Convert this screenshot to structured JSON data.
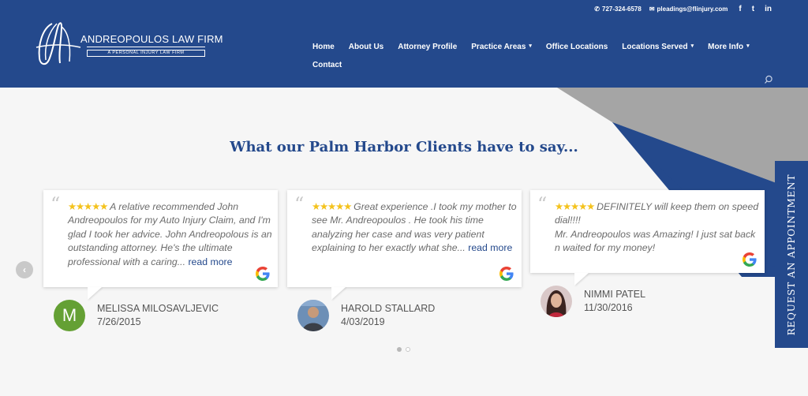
{
  "header": {
    "phone": "727-324-6578",
    "email": "pleadings@flinjury.com",
    "social": {
      "facebook": "f",
      "twitter": "t",
      "linkedin": "in"
    },
    "logo": {
      "name": "ANDREOPOULOS LAW FIRM",
      "tagline": "A PERSONAL INJURY LAW FIRM"
    },
    "nav_row1": [
      "Home",
      "About Us",
      "Attorney Profile",
      "Practice Areas",
      "Office Locations",
      "Locations Served",
      "More Info"
    ],
    "nav_row2": [
      "Contact"
    ],
    "nav_dropdowns": [
      "Practice Areas",
      "Locations Served",
      "More Info"
    ]
  },
  "section": {
    "heading": "What our Palm Harbor Clients have to say..."
  },
  "reviews": [
    {
      "stars": "★★★★★",
      "text": "A relative recommended John Andreopoulos for my Auto Injury Claim, and I'm glad I took her advice. John Andreopolous is an outstanding attorney. He's the ultimate professional with a caring...",
      "more": "read more",
      "name": "MELISSA MILOSAVLJEVIC",
      "date": "7/26/2015",
      "avatar_letter": "M"
    },
    {
      "stars": "★★★★★",
      "text": "Great experience .I took my mother to see Mr. Andreopoulos . He took his time analyzing her case and was very patient explaining to her exactly what she...",
      "more": "read more",
      "name": "HAROLD STALLARD",
      "date": "4/03/2019"
    },
    {
      "stars": "★★★★★",
      "text_line1": "DEFINITELY will keep them on speed dial!!!!",
      "text_line2": "Mr. Andreopoulos was Amazing! I just sat back n waited for my money!",
      "name": "NIMMI PATEL",
      "date": "11/30/2016"
    }
  ],
  "cta": {
    "label": "REQUEST AN APPOINTMENT"
  },
  "colors": {
    "brand_blue": "#24498c",
    "star_gold": "#f4c21c",
    "gray_shape": "#a5a5a5"
  }
}
